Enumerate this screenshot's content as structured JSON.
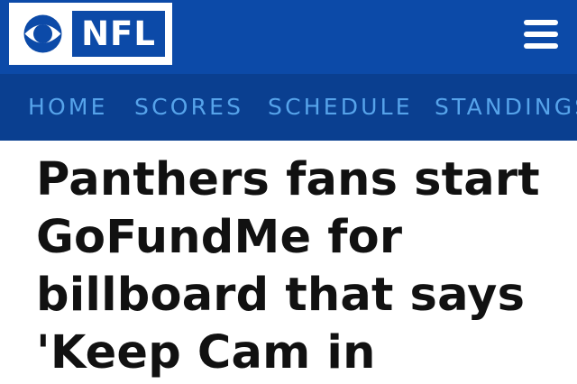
{
  "header": {
    "logo_text": "NFL",
    "logo_icon": "cbs-eye-icon",
    "menu_icon": "hamburger-menu-icon",
    "brand_color": "#0c4aa8"
  },
  "nav": {
    "items": [
      {
        "label": "HOME"
      },
      {
        "label": "SCORES"
      },
      {
        "label": "SCHEDULE"
      },
      {
        "label": "STANDINGS"
      }
    ],
    "background_color": "#0a3f90",
    "text_color": "#56a3ea"
  },
  "article": {
    "headline": "Panthers fans start GoFundMe for billboard that says 'Keep Cam in"
  }
}
